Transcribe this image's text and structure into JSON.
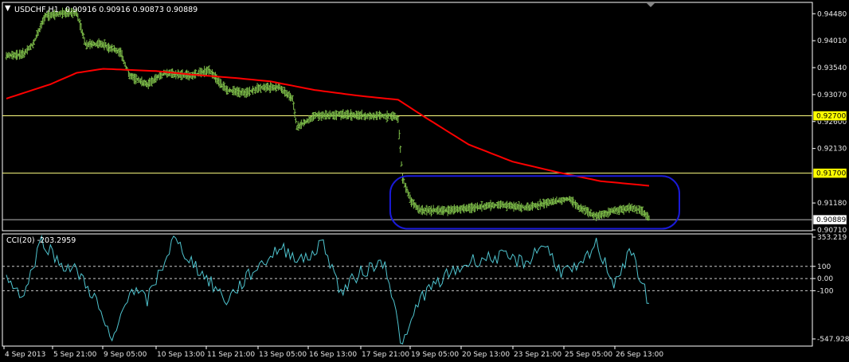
{
  "header": {
    "symbol": "USDCHF,H1",
    "ohlc": "0.90916 0.90916 0.90873 0.90889"
  },
  "colors": {
    "background": "#000000",
    "bars": "#7fbf4a",
    "ma": "#ff0000",
    "cci": "#4fc4cf",
    "hline": "#ffff80",
    "border": "#ffffff",
    "highlight": "#1a1ad8"
  },
  "chart_data": [
    {
      "type": "ohlc",
      "title": "USDCHF,H1",
      "ylim": [
        0.9071,
        0.9465
      ],
      "y_ticks": [
        "0.94480",
        "0.94010",
        "0.93540",
        "0.93070",
        "0.92600",
        "0.92130",
        "0.91180",
        "0.90710"
      ],
      "x_ticks": [
        "4 Sep 2013",
        "5 Sep 21:00",
        "9 Sep 05:00",
        "10 Sep 13:00",
        "11 Sep 21:00",
        "13 Sep 05:00",
        "16 Sep 13:00",
        "17 Sep 21:00",
        "19 Sep 05:00",
        "20 Sep 13:00",
        "23 Sep 21:00",
        "25 Sep 05:00",
        "26 Sep 13:00"
      ],
      "price_profile": [
        [
          0,
          0.9375
        ],
        [
          4,
          0.9378
        ],
        [
          6,
          0.9395
        ],
        [
          8,
          0.943
        ],
        [
          9,
          0.9445
        ],
        [
          14,
          0.945
        ],
        [
          16,
          0.945
        ],
        [
          18,
          0.9395
        ],
        [
          22,
          0.9395
        ],
        [
          26,
          0.938
        ],
        [
          28,
          0.934
        ],
        [
          32,
          0.9325
        ],
        [
          36,
          0.9345
        ],
        [
          42,
          0.934
        ],
        [
          46,
          0.935
        ],
        [
          50,
          0.9315
        ],
        [
          54,
          0.931
        ],
        [
          58,
          0.932
        ],
        [
          62,
          0.932
        ],
        [
          65,
          0.93
        ],
        [
          66,
          0.925
        ],
        [
          70,
          0.927
        ],
        [
          76,
          0.9272
        ],
        [
          82,
          0.927
        ],
        [
          88,
          0.927
        ],
        [
          89,
          0.9265
        ],
        [
          90,
          0.916
        ],
        [
          92,
          0.912
        ],
        [
          94,
          0.9105
        ],
        [
          100,
          0.9105
        ],
        [
          106,
          0.911
        ],
        [
          112,
          0.9115
        ],
        [
          118,
          0.911
        ],
        [
          124,
          0.912
        ],
        [
          128,
          0.9125
        ],
        [
          130,
          0.911
        ],
        [
          134,
          0.9095
        ],
        [
          138,
          0.9105
        ],
        [
          142,
          0.911
        ],
        [
          144,
          0.9105
        ],
        [
          146,
          0.9092
        ]
      ],
      "ma_profile": [
        [
          0,
          0.93
        ],
        [
          10,
          0.9325
        ],
        [
          16,
          0.9345
        ],
        [
          22,
          0.9352
        ],
        [
          28,
          0.935
        ],
        [
          34,
          0.9348
        ],
        [
          42,
          0.9342
        ],
        [
          52,
          0.9336
        ],
        [
          60,
          0.933
        ],
        [
          70,
          0.9315
        ],
        [
          80,
          0.9305
        ],
        [
          89,
          0.9298
        ],
        [
          95,
          0.9268
        ],
        [
          105,
          0.922
        ],
        [
          115,
          0.919
        ],
        [
          125,
          0.9172
        ],
        [
          135,
          0.9156
        ],
        [
          146,
          0.9148
        ]
      ],
      "horizontal_levels": [
        "0.92700",
        "0.91700",
        "0.90889"
      ],
      "highlight": "consolidation range after 19 Sep"
    },
    {
      "type": "line",
      "title": "CCI(20) -203.2959",
      "series_name": "CCI(20)",
      "last_value": -203.2959,
      "ylim": [
        -547.9286,
        353.219
      ],
      "y_ticks": [
        "353.219",
        "100",
        "0.00",
        "-100",
        "-547.9286"
      ],
      "cci_profile": [
        [
          0,
          0
        ],
        [
          4,
          -140
        ],
        [
          8,
          330
        ],
        [
          12,
          130
        ],
        [
          16,
          60
        ],
        [
          20,
          -150
        ],
        [
          24,
          -540
        ],
        [
          28,
          -80
        ],
        [
          32,
          -180
        ],
        [
          38,
          320
        ],
        [
          44,
          60
        ],
        [
          50,
          -180
        ],
        [
          56,
          60
        ],
        [
          62,
          250
        ],
        [
          68,
          150
        ],
        [
          72,
          300
        ],
        [
          76,
          -120
        ],
        [
          80,
          40
        ],
        [
          86,
          150
        ],
        [
          90,
          -570
        ],
        [
          94,
          -150
        ],
        [
          100,
          20
        ],
        [
          106,
          150
        ],
        [
          112,
          180
        ],
        [
          118,
          130
        ],
        [
          122,
          290
        ],
        [
          126,
          60
        ],
        [
          130,
          70
        ],
        [
          134,
          280
        ],
        [
          138,
          -30
        ],
        [
          142,
          220
        ],
        [
          146,
          -203
        ]
      ]
    }
  ]
}
